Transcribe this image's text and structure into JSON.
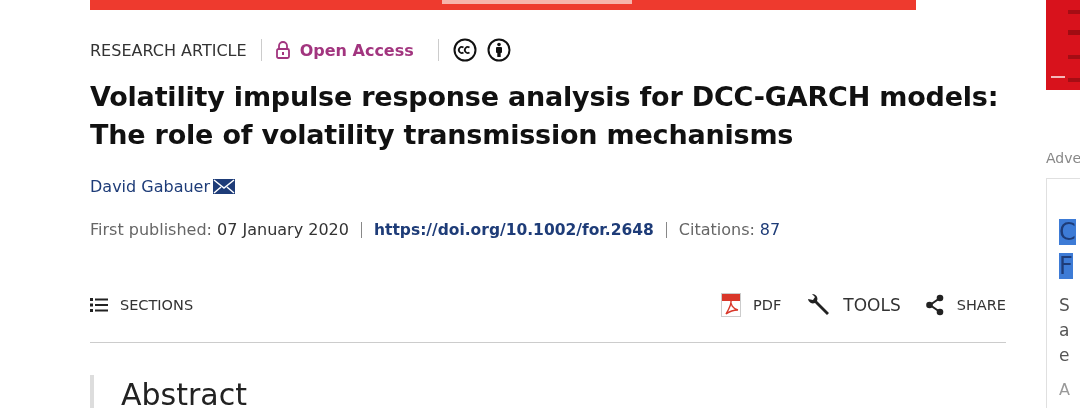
{
  "article_type": "RESEARCH ARTICLE",
  "access": {
    "label": "Open Access"
  },
  "title_lines": [
    "Volatility impulse response analysis for DCC-GARCH models:",
    "The role of volatility transmission mechanisms"
  ],
  "author": {
    "name": "David Gabauer"
  },
  "publication": {
    "label": "First published:",
    "date": "07 January 2020",
    "doi": "https://doi.org/10.1002/for.2648",
    "citations_label": "Citations:",
    "citations": "87"
  },
  "toolbar": {
    "sections": "SECTIONS",
    "actions": [
      {
        "kind": "pdf",
        "label": "PDF"
      },
      {
        "kind": "tools",
        "label": "TOOLS"
      },
      {
        "kind": "share",
        "label": "SHARE"
      }
    ]
  },
  "abstract_heading": "Abstract",
  "sidebar": {
    "ad_label": "Adve",
    "card_heading": [
      "C",
      "F"
    ],
    "card_text": [
      "S",
      "a",
      "e"
    ],
    "card_footer": "A"
  }
}
